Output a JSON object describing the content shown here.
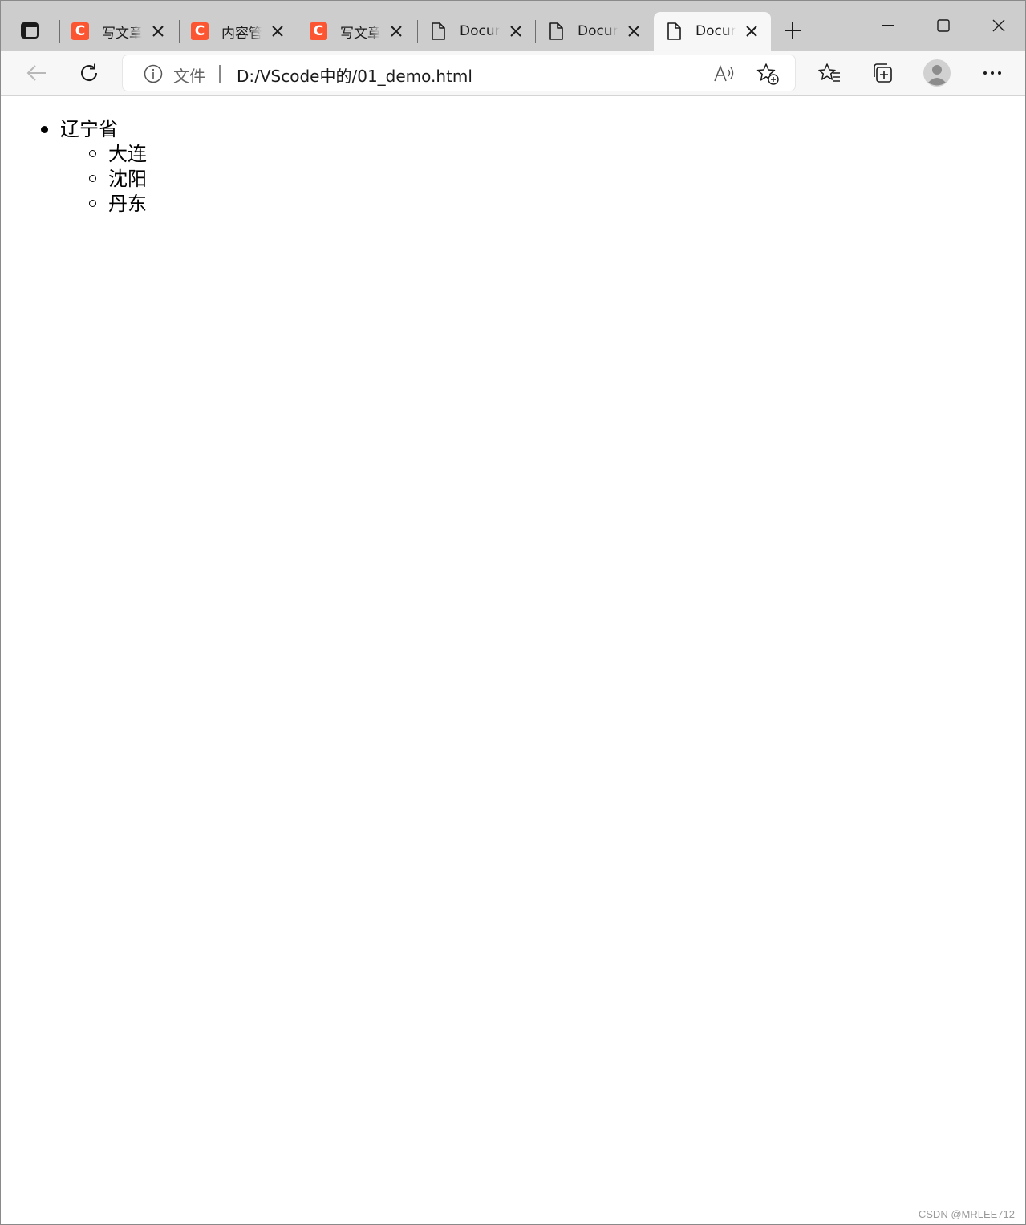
{
  "browser": {
    "tabs": [
      {
        "title": "写文章",
        "favicon": "csdn-logo-icon",
        "favicon_text": "C",
        "active": false
      },
      {
        "title": "内容管",
        "favicon": "csdn-logo-icon",
        "favicon_text": "C",
        "active": false
      },
      {
        "title": "写文章",
        "favicon": "csdn-logo-icon",
        "favicon_text": "C",
        "active": false
      },
      {
        "title": "Docur",
        "favicon": "document-icon",
        "active": false
      },
      {
        "title": "Docur",
        "favicon": "document-icon",
        "active": false
      },
      {
        "title": "Docur",
        "favicon": "document-icon",
        "active": true
      }
    ],
    "address": {
      "scheme_label": "文件",
      "url": "D:/VScode中的/01_demo.html"
    },
    "colors": {
      "tabstrip_bg": "#cdcdcd",
      "toolbar_bg": "#f7f7f7",
      "csdn_brand": "#fc5531"
    }
  },
  "page": {
    "list": {
      "label": "辽宁省",
      "items": [
        "大连",
        "沈阳",
        "丹东"
      ]
    }
  },
  "watermark": "CSDN @MRLEE712"
}
